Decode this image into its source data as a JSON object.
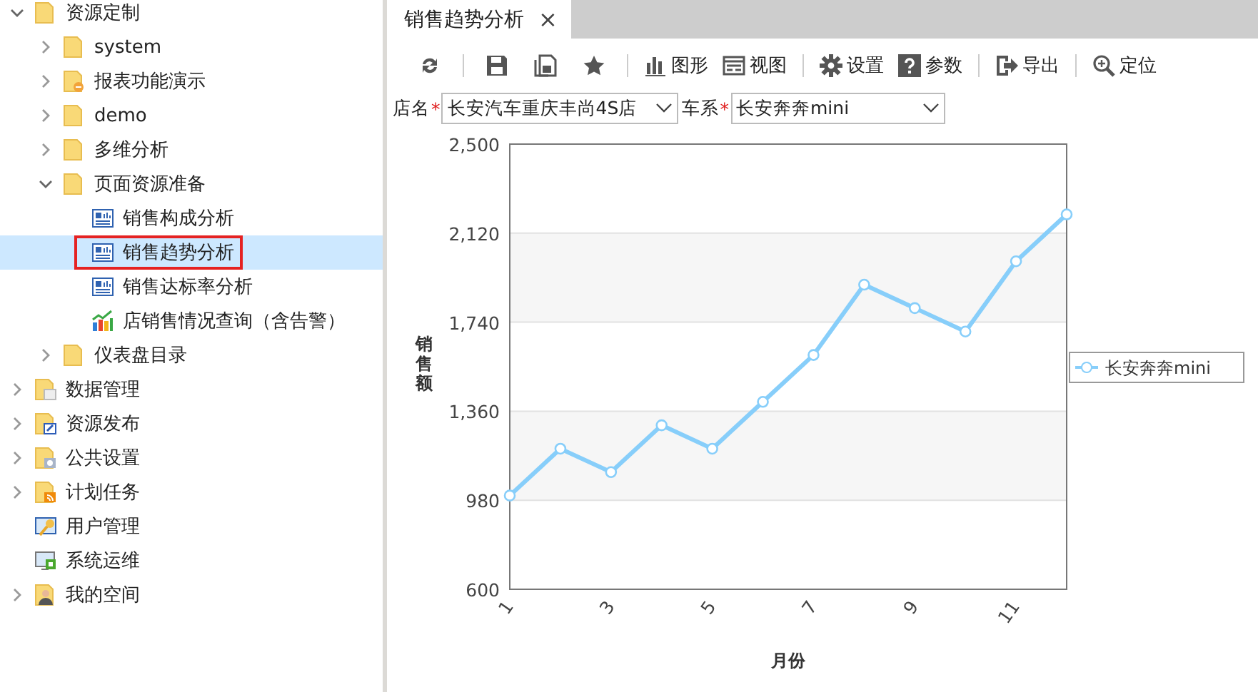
{
  "sidebar": {
    "tree": [
      {
        "label": "资源定制",
        "kind": "folder",
        "expanded": true,
        "selected": false,
        "children": [
          {
            "label": "system",
            "kind": "folder",
            "expanded": false,
            "selected": false
          },
          {
            "label": "报表功能演示",
            "kind": "folder-report",
            "expanded": false,
            "selected": false
          },
          {
            "label": "demo",
            "kind": "folder",
            "expanded": false,
            "selected": false
          },
          {
            "label": "多维分析",
            "kind": "folder",
            "expanded": false,
            "selected": false
          },
          {
            "label": "页面资源准备",
            "kind": "folder",
            "expanded": true,
            "selected": false,
            "children": [
              {
                "label": "销售构成分析",
                "kind": "report",
                "selected": false
              },
              {
                "label": "销售趋势分析",
                "kind": "report",
                "selected": true
              },
              {
                "label": "销售达标率分析",
                "kind": "report",
                "selected": false
              },
              {
                "label": "店销售情况查询（含告警）",
                "kind": "chart-report",
                "selected": false
              }
            ]
          },
          {
            "label": "仪表盘目录",
            "kind": "folder",
            "expanded": false,
            "selected": false
          }
        ]
      },
      {
        "label": "数据管理",
        "kind": "folder-data",
        "expanded": false,
        "selected": false
      },
      {
        "label": "资源发布",
        "kind": "folder-publish",
        "expanded": false,
        "selected": false
      },
      {
        "label": "公共设置",
        "kind": "folder-settings",
        "expanded": false,
        "selected": false
      },
      {
        "label": "计划任务",
        "kind": "folder-task",
        "expanded": false,
        "selected": false
      },
      {
        "label": "用户管理",
        "kind": "user-admin",
        "selected": false
      },
      {
        "label": "系统运维",
        "kind": "system",
        "selected": false
      },
      {
        "label": "我的空间",
        "kind": "my-space",
        "expanded": false,
        "selected": false
      }
    ]
  },
  "tabs": [
    {
      "label": "销售趋势分析",
      "selected": true,
      "close": "×"
    }
  ],
  "toolbar": [
    {
      "kind": "refresh"
    },
    {
      "kind": "separator"
    },
    {
      "kind": "save"
    },
    {
      "kind": "save-as"
    },
    {
      "kind": "star"
    },
    {
      "kind": "separator"
    },
    {
      "kind": "chart",
      "label": "图形"
    },
    {
      "kind": "view",
      "label": "视图"
    },
    {
      "kind": "separator"
    },
    {
      "kind": "settings",
      "label": "设置"
    },
    {
      "kind": "help",
      "label": "参数"
    },
    {
      "kind": "separator"
    },
    {
      "kind": "export",
      "label": "导出"
    },
    {
      "kind": "separator"
    },
    {
      "kind": "locate",
      "label": "定位"
    }
  ],
  "parameters": [
    {
      "label": "店名",
      "required_mark": "*",
      "value": "长安汽车重庆丰尚4S店"
    },
    {
      "label": "车系",
      "required_mark": "*",
      "value": "长安奔奔mini"
    }
  ],
  "chart": {
    "chart_data": {
      "type": "line",
      "xlabel": "月份",
      "ylabel": "销售额",
      "x": [
        1,
        2,
        3,
        4,
        5,
        6,
        7,
        8,
        9,
        10,
        11,
        12
      ],
      "grid": true,
      "series": [
        {
          "name": "长安奔奔mini",
          "color": "#87cefa",
          "marker": "circle",
          "values": [
            1000,
            1200,
            1100,
            1300,
            1200,
            1400,
            1600,
            1900,
            1800,
            1700,
            2000,
            2200
          ]
        }
      ],
      "xlim": [
        1,
        12
      ],
      "ylim": [
        600,
        2500
      ],
      "xticks": [
        1,
        3,
        5,
        7,
        9,
        11
      ],
      "yticks": [
        {
          "value": 600,
          "label": "600"
        },
        {
          "value": 980,
          "label": "980"
        },
        {
          "value": 1360,
          "label": "1,360"
        },
        {
          "value": 1740,
          "label": "1,740"
        },
        {
          "value": 2120,
          "label": "2,120"
        },
        {
          "value": 2500,
          "label": "2,500"
        }
      ]
    }
  }
}
